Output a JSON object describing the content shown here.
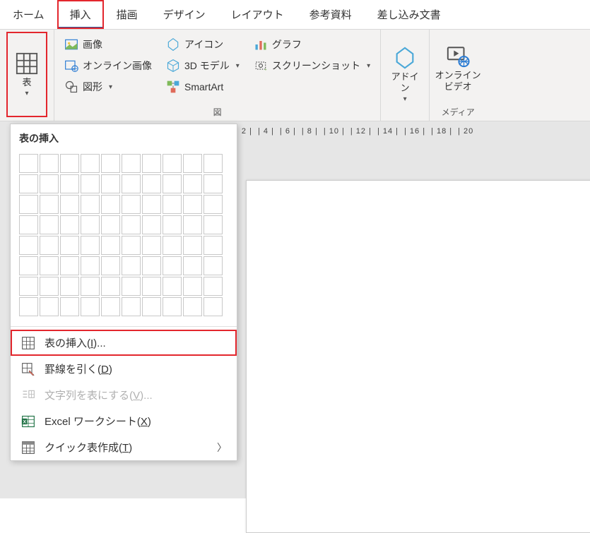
{
  "tabs": {
    "home": "ホーム",
    "insert": "挿入",
    "draw": "描画",
    "design": "デザイン",
    "layout": "レイアウト",
    "references": "参考資料",
    "mailings": "差し込み文書"
  },
  "ribbon": {
    "table": {
      "label": "表"
    },
    "illustrations": {
      "image": "画像",
      "onlineImages": "オンライン画像",
      "shapes": "図形",
      "icons": "アイコン",
      "model3d": "3D モデル",
      "smartart": "SmartArt",
      "chart": "グラフ",
      "screenshot": "スクリーンショット",
      "groupLabel": "図"
    },
    "addins": {
      "label": "アドイ\nン"
    },
    "media": {
      "onlineVideo": "オンライン\nビデオ",
      "groupLabel": "メディア"
    }
  },
  "dropdown": {
    "title": "表の挿入",
    "insertTable": {
      "prefix": "表の挿入(",
      "key": "I",
      "suffix": ")..."
    },
    "drawTable": {
      "prefix": "罫線を引く(",
      "key": "D",
      "suffix": ")"
    },
    "textToTable": {
      "prefix": "文字列を表にする(",
      "key": "V",
      "suffix": ")..."
    },
    "excelSheet": {
      "prefix": "Excel ワークシート(",
      "key": "X",
      "suffix": ")"
    },
    "quickTables": {
      "prefix": "クイック表作成(",
      "key": "T",
      "suffix": ")"
    }
  },
  "ruler": {
    "ticks": [
      "| 2 |",
      "| 4 |",
      "| 6 |",
      "| 8 |",
      "| 10 |",
      "| 12 |",
      "| 14 |",
      "| 16 |",
      "| 18 |",
      "| 20"
    ]
  },
  "colors": {
    "accent": "#2b579a",
    "highlight": "#e3262d"
  }
}
